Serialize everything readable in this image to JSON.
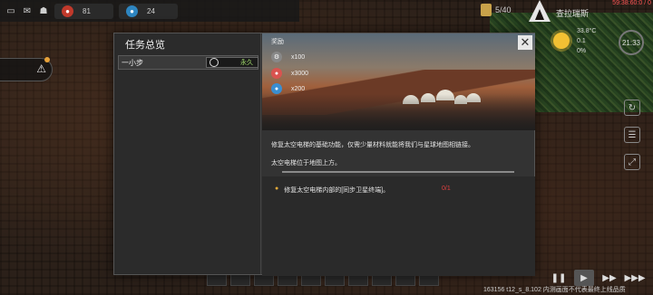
{
  "topbar": {
    "res1": {
      "value": "81",
      "color": "#c0392b"
    },
    "res2": {
      "value": "24",
      "color": "#2e86c1"
    },
    "population": "5/40",
    "player": "查拉瑞斯",
    "clock": "59:38:60:0 / 0"
  },
  "weather": {
    "temp": "33.8°C",
    "wind": "0.1",
    "rain": "0%",
    "time": "21:33"
  },
  "dialog": {
    "title": "任务总览",
    "task": {
      "name": "一小步",
      "duration": "永久"
    },
    "rewards_label": "奖励",
    "rewards": [
      {
        "icon": "gear-token-icon",
        "amount": "x100",
        "color": "#888888"
      },
      {
        "icon": "red-coin-icon",
        "amount": "x3000",
        "color": "#d9534f"
      },
      {
        "icon": "blue-coin-icon",
        "amount": "x200",
        "color": "#3a8ed0"
      }
    ],
    "description": "修复太空电梯的基础功能，仅需少量材料就能将我们与星球地图相链接。",
    "location": "太空电梯位于地图上方。",
    "goal": {
      "text": "修复太空电梯内部的[同步卫星终端]。",
      "progress": "0/1"
    }
  },
  "footer": {
    "version": "163156 t12_s_8.102  内测画面不代表最终上线品质"
  }
}
